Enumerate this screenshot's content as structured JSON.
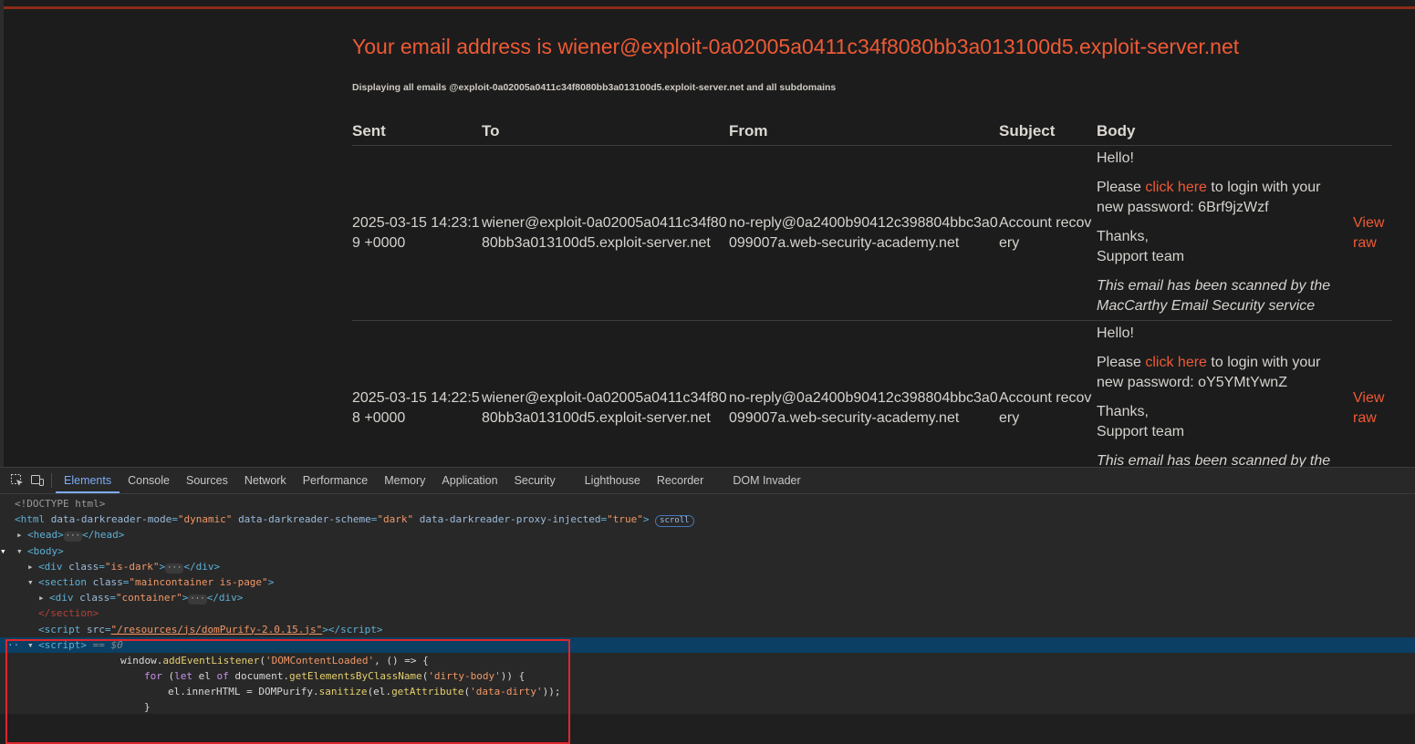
{
  "page": {
    "heading": "Your email address is wiener@exploit-0a02005a0411c34f8080bb3a013100d5.exploit-server.net",
    "subtitle": "Displaying all emails @exploit-0a02005a0411c34f8080bb3a013100d5.exploit-server.net and all subdomains",
    "columns": [
      "Sent",
      "To",
      "From",
      "Subject",
      "Body"
    ],
    "emails": [
      {
        "sent": "2025-03-15 14:23:19 +0000",
        "to": "wiener@exploit-0a02005a0411c34f8080bb3a013100d5.exploit-server.net",
        "from": "no-reply@0a2400b90412c398804bbc3a0099007a.web-security-academy.net",
        "subject": "Account recovery",
        "greeting": "Hello!",
        "please": "Please ",
        "link": "click here",
        "after_link": " to login with your new password: 6Brf9jzWzf",
        "thanks": "Thanks,",
        "team": "Support team",
        "note": "This email has been scanned by the MacCarthy Email Security service",
        "raw": "View raw"
      },
      {
        "sent": "2025-03-15 14:22:58 +0000",
        "to": "wiener@exploit-0a02005a0411c34f8080bb3a013100d5.exploit-server.net",
        "from": "no-reply@0a2400b90412c398804bbc3a0099007a.web-security-academy.net",
        "subject": "Account recovery",
        "greeting": "Hello!",
        "please": "Please ",
        "link": "click here",
        "after_link": " to login with your new password: oY5YMtYwnZ",
        "thanks": "Thanks,",
        "team": "Support team",
        "note": "This email has been scanned by the MacCarthy Email Security service",
        "raw": "View raw"
      }
    ]
  },
  "devtools": {
    "tabs": [
      "Elements",
      "Console",
      "Sources",
      "Network",
      "Performance",
      "Memory",
      "Application",
      "Security",
      "Lighthouse",
      "Recorder",
      "DOM Invader"
    ],
    "active_tab": "Elements",
    "dom": {
      "doctype": "<!DOCTYPE html>",
      "html_attr1": "data-darkreader-mode",
      "html_val1": "\"dynamic\"",
      "html_attr2": "data-darkreader-scheme",
      "html_val2": "\"dark\"",
      "html_attr3": "data-darkreader-proxy-injected",
      "html_val3": "\"true\"",
      "scroll_badge": "scroll",
      "div_class1": "\"is-dark\"",
      "section_class": "\"maincontainer is-page\"",
      "div_class2": "\"container\"",
      "script_src": "\"/resources/js/domPurify-2.0.15.js\"",
      "selected_marker": "== $0",
      "js_line1_obj": "window.",
      "js_line1_fn": "addEventListener",
      "js_line1_str": "'DOMContentLoaded'",
      "js_line1_rest": ", () => {",
      "js_line2_kw1": "for",
      "js_line2_a": " (",
      "js_line2_kw2": "let",
      "js_line2_b": " el ",
      "js_line2_kw3": "of",
      "js_line2_c": " document.",
      "js_line2_fn": "getElementsByClassName",
      "js_line2_str": "'dirty-body'",
      "js_line2_d": ")) {",
      "js_line3_a": "el.innerHTML = DOMPurify.",
      "js_line3_fn1": "sanitize",
      "js_line3_b": "(el.",
      "js_line3_fn2": "getAttribute",
      "js_line3_str": "'data-dirty'",
      "js_line3_c": "));",
      "js_line4": "}"
    }
  }
}
